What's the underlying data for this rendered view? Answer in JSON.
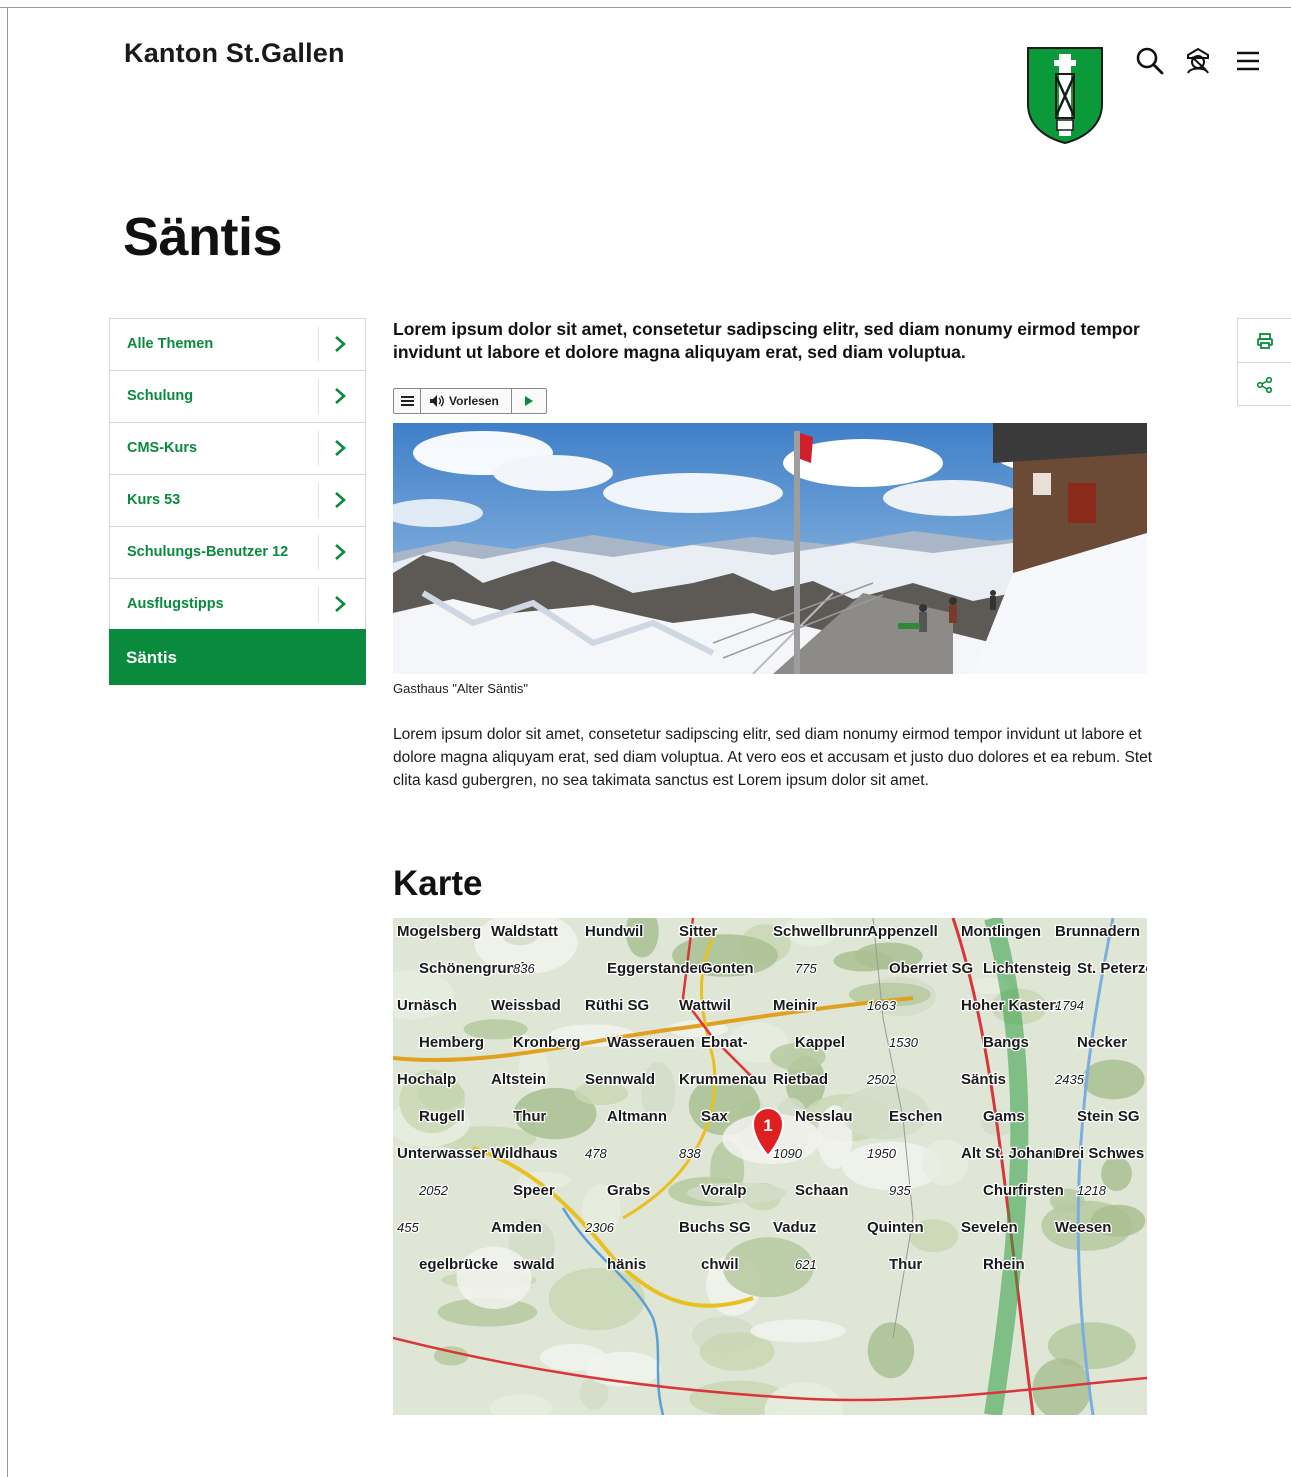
{
  "header": {
    "brand": "Kanton St.Gallen",
    "icons": [
      "canton-crest-icon",
      "search-icon",
      "login-icon",
      "menu-icon"
    ]
  },
  "page": {
    "title": "Säntis"
  },
  "sidebar": {
    "items": [
      {
        "label": "Alle Themen"
      },
      {
        "label": "Schulung"
      },
      {
        "label": "CMS-Kurs"
      },
      {
        "label": "Kurs 53"
      },
      {
        "label": "Schulungs-Benutzer 12"
      },
      {
        "label": "Ausflugstipps"
      }
    ],
    "active": "Säntis"
  },
  "content": {
    "lead": "Lorem ipsum dolor sit amet, consetetur sadipscing elitr, sed diam nonumy eirmod tempor invidunt ut labore et dolore magna aliquyam erat, sed diam voluptua.",
    "readspeaker": {
      "label": "Vorlesen"
    },
    "image_caption": "Gasthaus \"Alter Säntis\"",
    "body": "Lorem ipsum dolor sit amet, consetetur sadipscing elitr, sed diam nonumy eirmod tempor invidunt ut labore et dolore magna aliquyam erat, sed diam voluptua. At vero eos et accusam et justo duo dolores et ea rebum. Stet clita kasd gubergren, no sea takimata sanctus est Lorem ipsum dolor sit amet.",
    "map_heading": "Karte"
  },
  "map": {
    "marker": "1",
    "labels": [
      "Mogelsberg",
      "Waldstatt",
      "Hundwil",
      "Sitter",
      "Schwellbrunn",
      "Appenzell",
      "Montlingen",
      "Brunnadern",
      "Schönengrund",
      "836",
      "Eggerstanden",
      "Gonten",
      "775",
      "Oberriet SG",
      "Lichtensteig",
      "St. Peterzell",
      "Urnäsch",
      "Weissbad",
      "Rüthi SG",
      "Wattwil",
      "Meinir",
      "1663",
      "Hoher Kasten",
      "1794",
      "Hemberg",
      "Kronberg",
      "Wasserauen",
      "Ebnat-",
      "Kappel",
      "1530",
      "Bangs",
      "Necker",
      "Hochalp",
      "Altstein",
      "Sennwald",
      "Krummenau",
      "Rietbad",
      "2502",
      "Säntis",
      "2435",
      "Rugell",
      "Thur",
      "Altmann",
      "Sax",
      "Nesslau",
      "Eschen",
      "Gams",
      "Stein SG",
      "Unterwasser",
      "Wildhaus",
      "478",
      "838",
      "1090",
      "1950",
      "Alt St. Johann",
      "Drei Schwes",
      "2052",
      "Speer",
      "Grabs",
      "Voralp",
      "Schaan",
      "935",
      "Churfirsten",
      "1218",
      "455",
      "Amden",
      "2306",
      "Buchs SG",
      "Vaduz",
      "Quinten",
      "Sevelen",
      "Weesen",
      "egelbrücke",
      "swald",
      "hänis",
      "chwil",
      "621",
      "Thur",
      "Rhein"
    ]
  },
  "tools": {
    "icons": [
      "print-icon",
      "share-icon"
    ]
  }
}
